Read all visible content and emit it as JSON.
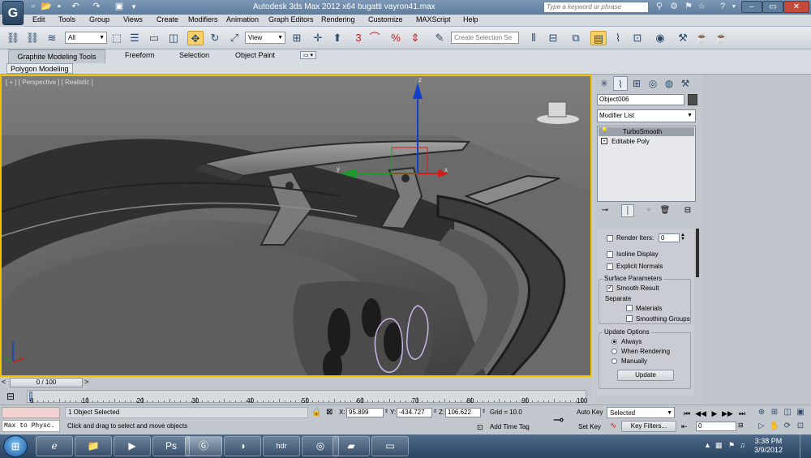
{
  "window": {
    "app_logo": "G",
    "title": "Autodesk 3ds Max  2012 x64     bugatti vayron41.max",
    "search_placeholder": "Type a keyword or phrase"
  },
  "menu": [
    "Edit",
    "Tools",
    "Group",
    "Views",
    "Create",
    "Modifiers",
    "Animation",
    "Graph Editors",
    "Rendering",
    "Customize",
    "MAXScript",
    "Help"
  ],
  "toolbar": {
    "selection_filter": "All",
    "ref_coord": "View",
    "selection_set_placeholder": "Create Selection Se",
    "snap_label": "3",
    "percent_label": "%"
  },
  "ribbon": {
    "tabs": [
      "Graphite Modeling Tools",
      "Freeform",
      "Selection",
      "Object Paint"
    ],
    "panel_label": "Polygon Modeling"
  },
  "viewport": {
    "label": "[ + ] [ Perspective ] [ Realistic ]",
    "gizmo_x": "x",
    "gizmo_y": "y",
    "gizmo_z": "z"
  },
  "command_panel": {
    "object_name": "Object006",
    "modifier_list": "Modifier List",
    "stack": [
      "TurboSmooth",
      "Editable Poly"
    ],
    "render_iters_label": "Render Iters:",
    "render_iters_value": "0",
    "isoline_display": "Isoline Display",
    "explicit_normals": "Explicit Normals",
    "surface_parameters": "Surface Parameters",
    "smooth_result": "Smooth Result",
    "separate": "Separate",
    "materials": "Materials",
    "smoothing_groups": "Smoothing Groups",
    "update_options": "Update Options",
    "always": "Always",
    "when_rendering": "When Rendering",
    "manually": "Manually",
    "update_button": "Update"
  },
  "timeline": {
    "slider_label": "0 / 100",
    "ticks": [
      "0",
      "10",
      "20",
      "30",
      "40",
      "50",
      "60",
      "70",
      "80",
      "90",
      "100"
    ]
  },
  "status": {
    "maxscript_line": "Max to Physc.",
    "selection_status": "1 Object Selected",
    "prompt": "Click and drag to select and move objects",
    "x_label": "X:",
    "x_value": "95.899",
    "y_label": "Y:",
    "y_value": "-434.727",
    "z_label": "Z:",
    "z_value": "106.622",
    "grid": "Grid = 10.0",
    "add_time_tag": "Add Time Tag",
    "auto_key": "Auto Key",
    "set_key": "Set Key",
    "selected_dd": "Selected",
    "key_filters": "Key Filters...",
    "frame": "0"
  },
  "taskbar": {
    "time": "3:38 PM",
    "date": "3/9/2012",
    "hdr_label": "hdr"
  }
}
